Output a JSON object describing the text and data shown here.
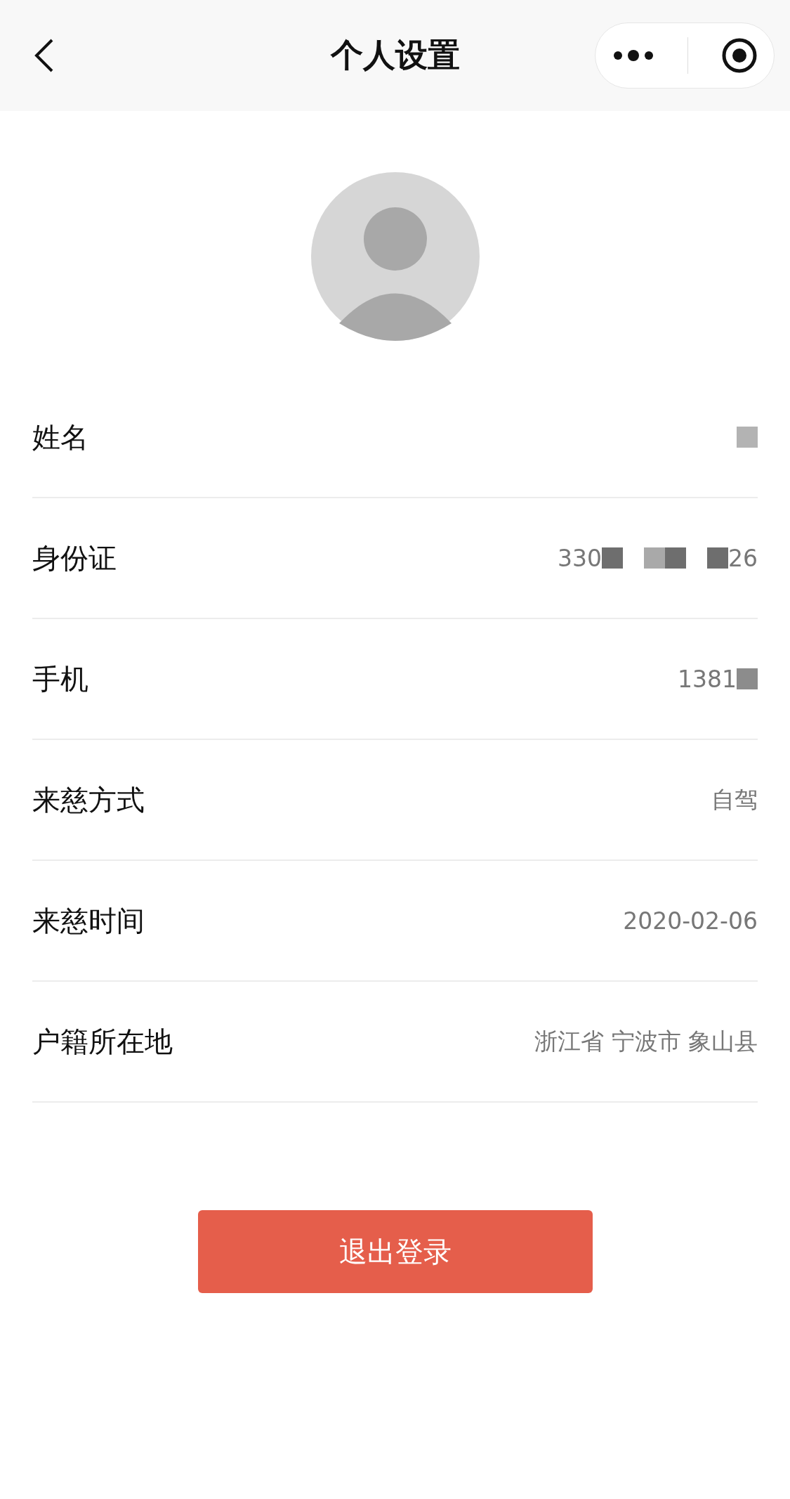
{
  "nav": {
    "title": "个人设置"
  },
  "rows": [
    {
      "label": "姓名",
      "value": [
        {
          "kind": "mask",
          "color": "#b3b3b3"
        }
      ]
    },
    {
      "label": "身份证",
      "value": [
        {
          "kind": "text",
          "text": "330"
        },
        {
          "kind": "mask",
          "color": "#6e6e6e"
        },
        {
          "kind": "gap"
        },
        {
          "kind": "mask",
          "color": "#a9a9a9"
        },
        {
          "kind": "mask",
          "color": "#6e6e6e"
        },
        {
          "kind": "gap"
        },
        {
          "kind": "mask",
          "color": "#6e6e6e"
        },
        {
          "kind": "text",
          "text": "26"
        }
      ]
    },
    {
      "label": "手机",
      "value": [
        {
          "kind": "text",
          "text": "1381"
        },
        {
          "kind": "mask",
          "color": "#8c8c8c"
        }
      ]
    },
    {
      "label": "来慈方式",
      "value": [
        {
          "kind": "text",
          "text": "自驾"
        }
      ]
    },
    {
      "label": "来慈时间",
      "value": [
        {
          "kind": "text",
          "text": "2020-02-06"
        }
      ]
    },
    {
      "label": "户籍所在地",
      "value": [
        {
          "kind": "text",
          "text": "浙江省 宁波市 象山县"
        }
      ]
    }
  ],
  "logout_button": "退出登录"
}
